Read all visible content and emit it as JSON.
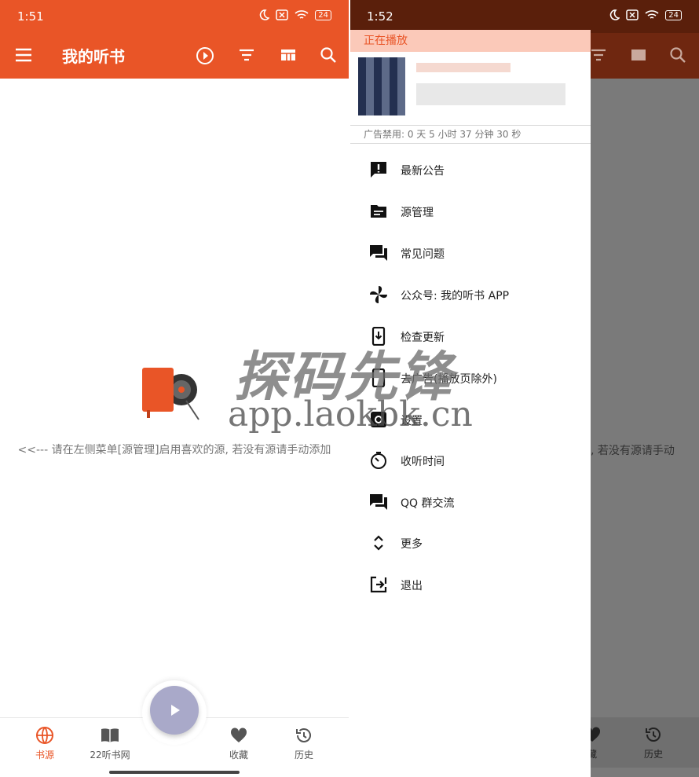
{
  "left": {
    "status": {
      "time": "1:51",
      "battery": "24"
    },
    "appbar": {
      "title": "我的听书"
    },
    "empty_hint": "<<--- 请在左侧菜单[源管理]启用喜欢的源, 若没有源请手动添加",
    "bottom_nav": [
      "书源",
      "22听书网",
      "收藏",
      "历史"
    ]
  },
  "right": {
    "status": {
      "time": "1:52",
      "battery": "24"
    },
    "drawer": {
      "now_playing": "正在播放",
      "ad_info": "广告禁用: 0 天 5 小时 37 分钟 30 秒",
      "menu": [
        {
          "label": "最新公告",
          "icon": "announcement-icon"
        },
        {
          "label": "源管理",
          "icon": "folder-icon"
        },
        {
          "label": "常见问题",
          "icon": "forum-icon"
        },
        {
          "label": "公众号: 我的听书 APP",
          "icon": "pinwheel-icon"
        },
        {
          "label": "检查更新",
          "icon": "phone-download-icon"
        },
        {
          "label": "去广告(播放页除外)",
          "icon": "phone-icon"
        },
        {
          "label": "设置",
          "icon": "settings-icon"
        },
        {
          "label": "收听时间",
          "icon": "timer-icon"
        },
        {
          "label": "QQ 群交流",
          "icon": "forum-icon"
        },
        {
          "label": "更多",
          "icon": "expand-icon"
        },
        {
          "label": "退出",
          "icon": "exit-icon"
        }
      ]
    },
    "behind_hint": ", 若没有源请手动",
    "bottom_nav": [
      "藏",
      "历史"
    ]
  },
  "watermark": {
    "line1": "探码先锋",
    "line2": "app.laokbk.cn"
  },
  "colors": {
    "primary": "#e95527",
    "dark_primary": "#5a1f0b",
    "scrim": "#7a7a7a",
    "now_playing_bg": "#fbc9b9"
  }
}
